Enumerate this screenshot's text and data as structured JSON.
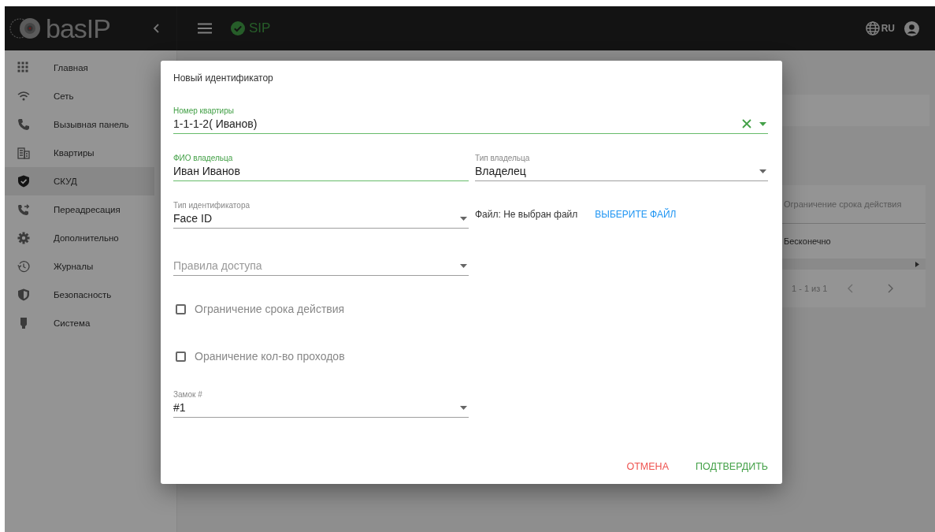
{
  "header": {
    "logo": "basIP",
    "sip": {
      "label": "SIP",
      "registered": true
    },
    "language": "RU"
  },
  "sidebar": {
    "items": [
      {
        "label": "Главная",
        "selected": false
      },
      {
        "label": "Сеть",
        "selected": false
      },
      {
        "label": "Вызывная панель",
        "selected": false
      },
      {
        "label": "Квартиры",
        "selected": false
      },
      {
        "label": "СКУД",
        "selected": true
      },
      {
        "label": "Переадресация",
        "selected": false
      },
      {
        "label": "Дополнительно",
        "selected": false
      },
      {
        "label": "Журналы",
        "selected": false
      },
      {
        "label": "Безопасность",
        "selected": false
      },
      {
        "label": "Система",
        "selected": false
      }
    ]
  },
  "table": {
    "columns": [
      "Ограничение срока действия"
    ],
    "rows": [
      [
        "Бесконечно"
      ]
    ],
    "pagination": "1 - 1 из 1"
  },
  "dialog": {
    "title": "Новый идентификатор",
    "fields": [
      {
        "kind": "select",
        "label": "Номер квартиры",
        "value": "1-1-1-2( Иванов)",
        "focused": true,
        "clearable": true
      },
      {
        "kind": "text",
        "label": "ФИО владельца",
        "value": "Иван Иванов",
        "focused": true
      },
      {
        "kind": "select",
        "label": "Тип владельца",
        "value": "Владелец",
        "focused": false
      },
      {
        "kind": "select",
        "label": "Тип идентификатора",
        "value": "Face ID",
        "focused": false
      },
      {
        "kind": "file",
        "label": "Файл: Не выбран файл",
        "button": "ВЫБЕРИТЕ ФАЙЛ"
      },
      {
        "kind": "select",
        "placeholder": "Правила доступа",
        "focused": false
      },
      {
        "kind": "checkbox",
        "label": "Ограничение срока действия",
        "checked": false
      },
      {
        "kind": "checkbox",
        "label": "Ораничение кол-во проходов",
        "checked": false
      },
      {
        "kind": "select",
        "label": "Замок #",
        "value": "#1",
        "focused": false
      }
    ],
    "buttons": [
      {
        "label": "ОТМЕНА",
        "kind": "cancel"
      },
      {
        "label": "ПОДТВЕРДИТЬ",
        "kind": "confirm"
      }
    ]
  }
}
